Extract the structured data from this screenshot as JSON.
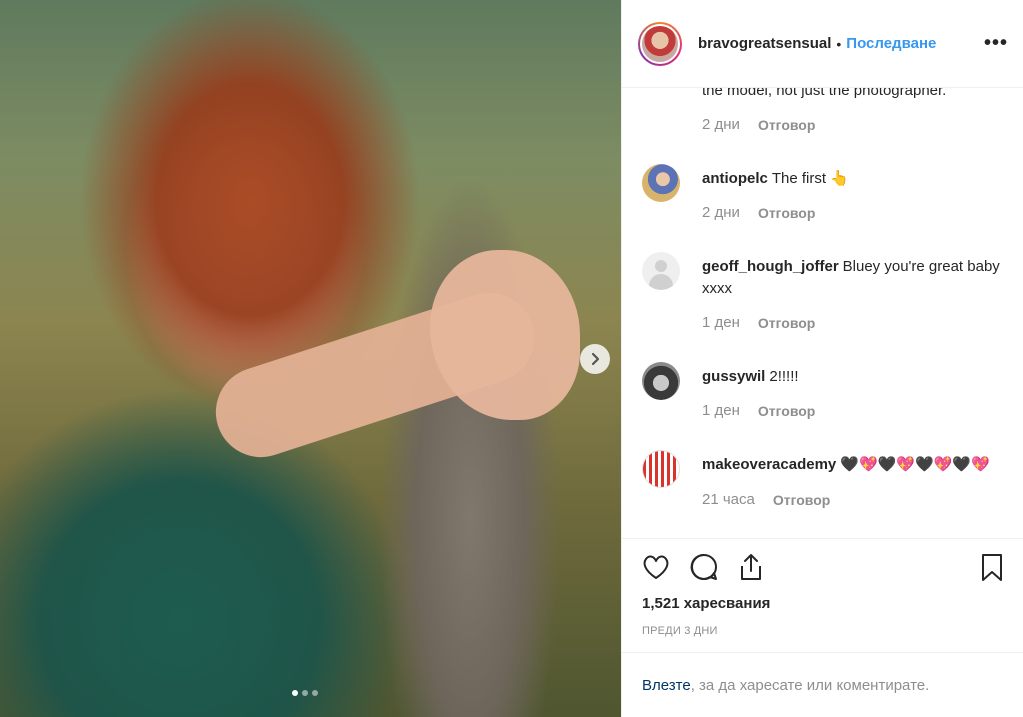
{
  "post": {
    "username": "bravogreatsensual",
    "separator": "•",
    "follow_label": "Последване",
    "more_label": "•••"
  },
  "comments": {
    "partial_text": "the model, not just the photographer.",
    "partial_meta": {
      "time": "2 дни",
      "reply": "Отговор"
    },
    "items": [
      {
        "username": "antiopelc",
        "text": "The first 👆",
        "time": "2 дни",
        "reply": "Отговор"
      },
      {
        "username": "geoff_hough_joffer",
        "text": "Bluey you're great baby xxxx",
        "time": "1 ден",
        "reply": "Отговор"
      },
      {
        "username": "gussywil",
        "text": "2!!!!!",
        "time": "1 ден",
        "reply": "Отговор"
      },
      {
        "username": "makeoveracademy",
        "text": "🖤💖🖤💖🖤💖🖤💖",
        "time": "21 часа",
        "reply": "Отговор"
      }
    ]
  },
  "actions": {
    "likes": "1,521 харесвания",
    "posted": "ПРЕДИ 3 ДНИ"
  },
  "login": {
    "link": "Влезте",
    "rest": ", за да харесате или коментирате."
  },
  "carousel": {
    "current": 1,
    "total": 3
  }
}
